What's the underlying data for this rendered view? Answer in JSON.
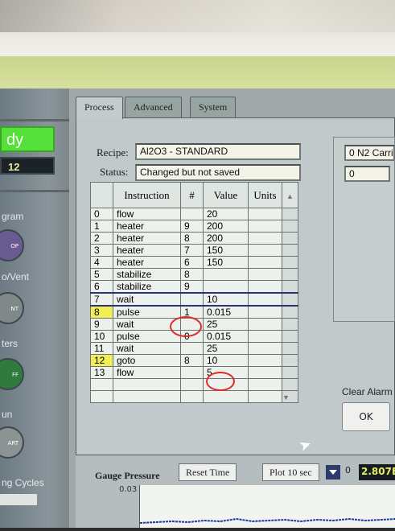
{
  "left_panel": {
    "status_text": "dy",
    "run_count": "12",
    "labels": [
      "gram",
      "o/Vent",
      "ters",
      "un",
      "ng Cycles"
    ],
    "buttons": [
      {
        "text": "OP",
        "color": "#6a5a92"
      },
      {
        "text": "NT",
        "color": "#7e8988"
      },
      {
        "text": "FF",
        "color": "#2f7a3d"
      },
      {
        "text": "ART",
        "color": "#8b9493"
      }
    ]
  },
  "tabs": [
    "Process",
    "Advanced",
    "System"
  ],
  "recipe": {
    "label": "Recipe:",
    "value": "Al2O3 - STANDARD"
  },
  "status": {
    "label": "Status:",
    "value": "Changed but not saved"
  },
  "right_panel": {
    "field1": "0 N2 Carri",
    "field2": "0"
  },
  "table": {
    "headers": [
      "Instruction",
      "#",
      "Value",
      "Units"
    ],
    "rows": [
      {
        "i": "0",
        "instr": "flow",
        "num": "",
        "val": "20"
      },
      {
        "i": "1",
        "instr": "heater",
        "num": "9",
        "val": "200"
      },
      {
        "i": "2",
        "instr": "heater",
        "num": "8",
        "val": "200"
      },
      {
        "i": "3",
        "instr": "heater",
        "num": "7",
        "val": "150"
      },
      {
        "i": "4",
        "instr": "heater",
        "num": "6",
        "val": "150"
      },
      {
        "i": "5",
        "instr": "stabilize",
        "num": "8",
        "val": ""
      },
      {
        "i": "6",
        "instr": "stabilize",
        "num": "9",
        "val": ""
      },
      {
        "i": "7",
        "instr": "wait",
        "num": "",
        "val": "10"
      },
      {
        "i": "8",
        "instr": "pulse",
        "num": "1",
        "val": "0.015"
      },
      {
        "i": "9",
        "instr": "wait",
        "num": "",
        "val": "25"
      },
      {
        "i": "10",
        "instr": "pulse",
        "num": "0",
        "val": "0.015"
      },
      {
        "i": "11",
        "instr": "wait",
        "num": "",
        "val": "25"
      },
      {
        "i": "12",
        "instr": "goto",
        "num": "8",
        "val": "10"
      },
      {
        "i": "13",
        "instr": "flow",
        "num": "",
        "val": "5"
      }
    ]
  },
  "alarm": {
    "label": "Clear Alarm",
    "ok": "OK"
  },
  "gauge": {
    "label": "Gauge Pressure",
    "reset": "Reset Time",
    "plot": "Plot 10 sec",
    "zero": "0",
    "value": "2.807E",
    "ytick": "0.03"
  }
}
